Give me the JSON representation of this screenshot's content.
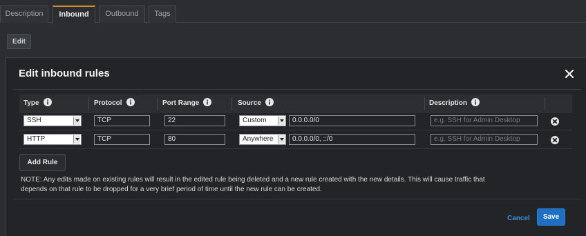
{
  "tabs": [
    {
      "label": "Description",
      "active": false
    },
    {
      "label": "Inbound",
      "active": true
    },
    {
      "label": "Outbound",
      "active": false
    },
    {
      "label": "Tags",
      "active": false
    }
  ],
  "page_edit_label": "Edit",
  "modal": {
    "title": "Edit inbound rules",
    "columns": {
      "type": "Type",
      "protocol": "Protocol",
      "port_range": "Port Range",
      "source": "Source",
      "description": "Description"
    },
    "rules": [
      {
        "type": "SSH",
        "protocol": "TCP",
        "port_range": "22",
        "source_type": "Custom",
        "source_value": "0.0.0.0/0",
        "description_placeholder": "e.g. SSH for Admin Desktop"
      },
      {
        "type": "HTTP",
        "protocol": "TCP",
        "port_range": "80",
        "source_type": "Anywhere",
        "source_value": "0.0.0.0/0, ::/0",
        "description_placeholder": "e.g. SSH for Admin Desktop"
      }
    ],
    "add_rule_label": "Add Rule",
    "note_line1": "NOTE: Any edits made on existing rules will result in the edited rule being deleted and a new rule created with the new details. This will cause traffic that",
    "note_line2": "depends on that rule to be dropped for a very brief period of time until the new rule can be created.",
    "cancel_label": "Cancel",
    "save_label": "Save"
  },
  "colors": {
    "accent_tab": "#d28a2c",
    "save_button": "#1f6fc2",
    "cancel_link": "#3b8fd9",
    "background": "#2b2d31",
    "modal": "#232427"
  },
  "icons": [
    "info-icon",
    "close-icon",
    "remove-icon",
    "dropdown-arrow-icon"
  ]
}
